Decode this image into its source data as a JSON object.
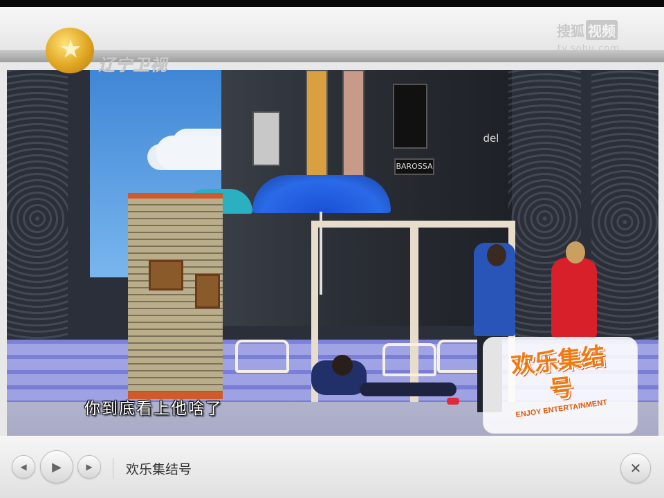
{
  "header": {
    "channel_logo_text": "辽宁卫视",
    "watermark_brand": "搜狐",
    "watermark_video": "视频",
    "watermark_url": "tv.sohu.com"
  },
  "video": {
    "subtitle": "你到底看上他啥了",
    "show_badge_title": "欢乐集结号",
    "show_badge_subtitle": "ENJOY ENTERTAINMENT",
    "sign_text_1": "BAROSSA",
    "sign_text_2": "del"
  },
  "controls": {
    "prev_icon": "◀",
    "play_icon": "▶",
    "next_icon": "▶",
    "close_icon": "✕",
    "title": "欢乐集结号"
  },
  "colors": {
    "accent": "#e07a10",
    "umbrella": "#2a6ae8",
    "curtain_red": "#e03a2a"
  }
}
